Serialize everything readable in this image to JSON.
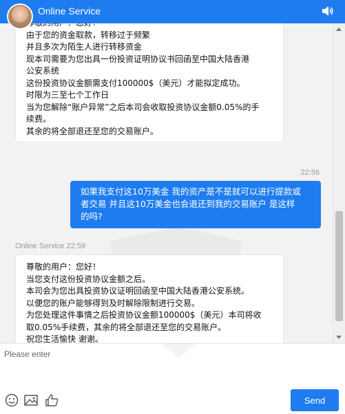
{
  "header": {
    "title": "Online Service",
    "avatar_icon": "agent-avatar",
    "sound_icon": "speaker-icon"
  },
  "messages": [
    {
      "type": "incoming",
      "lines": [
        "尊敬的用户：您好！",
        "由于您的资金取款，转移过于频繁",
        "并且多次为陌生人进行转移资金",
        "现本司需要为您出具一份投资证明协议书回函至中国大陆香港",
        "公安系统",
        "这份投资协议金额需支付100000$（美元）才能拟定成功。",
        "时限为三至七个工作日",
        "当为您解除“账户异常”之后本司会收取投资协议金额0.05%的手",
        "续费。",
        "其余的将全部退还至您的交易账户。"
      ]
    },
    {
      "type": "outgoing",
      "time": "22:56",
      "lines": [
        "如果我支付这10万美金 我的资产是不是就可以进行提款或",
        "者交易 并且这10万美金也会退还到我的交易账户 是这样",
        "的吗?"
      ]
    },
    {
      "type": "incoming",
      "sender": "Online Service 22:59",
      "lines": [
        "尊敬的用户：您好！",
        "当您支付这份投资协议金额之后。",
        "本司会为您出具投资协议证明回函至中国大陆香港公安系统。",
        "以便您的账户能够得到及时解除限制进行交易。",
        "为您处理这件事情之后投资协议金额100000$（美元）本司将收",
        "取0.05%手续费，其余的将全部退还至您的交易账户。",
        "祝您生活愉快 谢谢。"
      ]
    }
  ],
  "input": {
    "placeholder": "Please enter",
    "value": ""
  },
  "toolbar": {
    "icons": [
      "emoji-icon",
      "image-icon",
      "thumbs-up-icon"
    ],
    "send_label": "Send"
  },
  "colors": {
    "brand": "#1e7cf0",
    "chat_background": "#f2f2f2"
  }
}
